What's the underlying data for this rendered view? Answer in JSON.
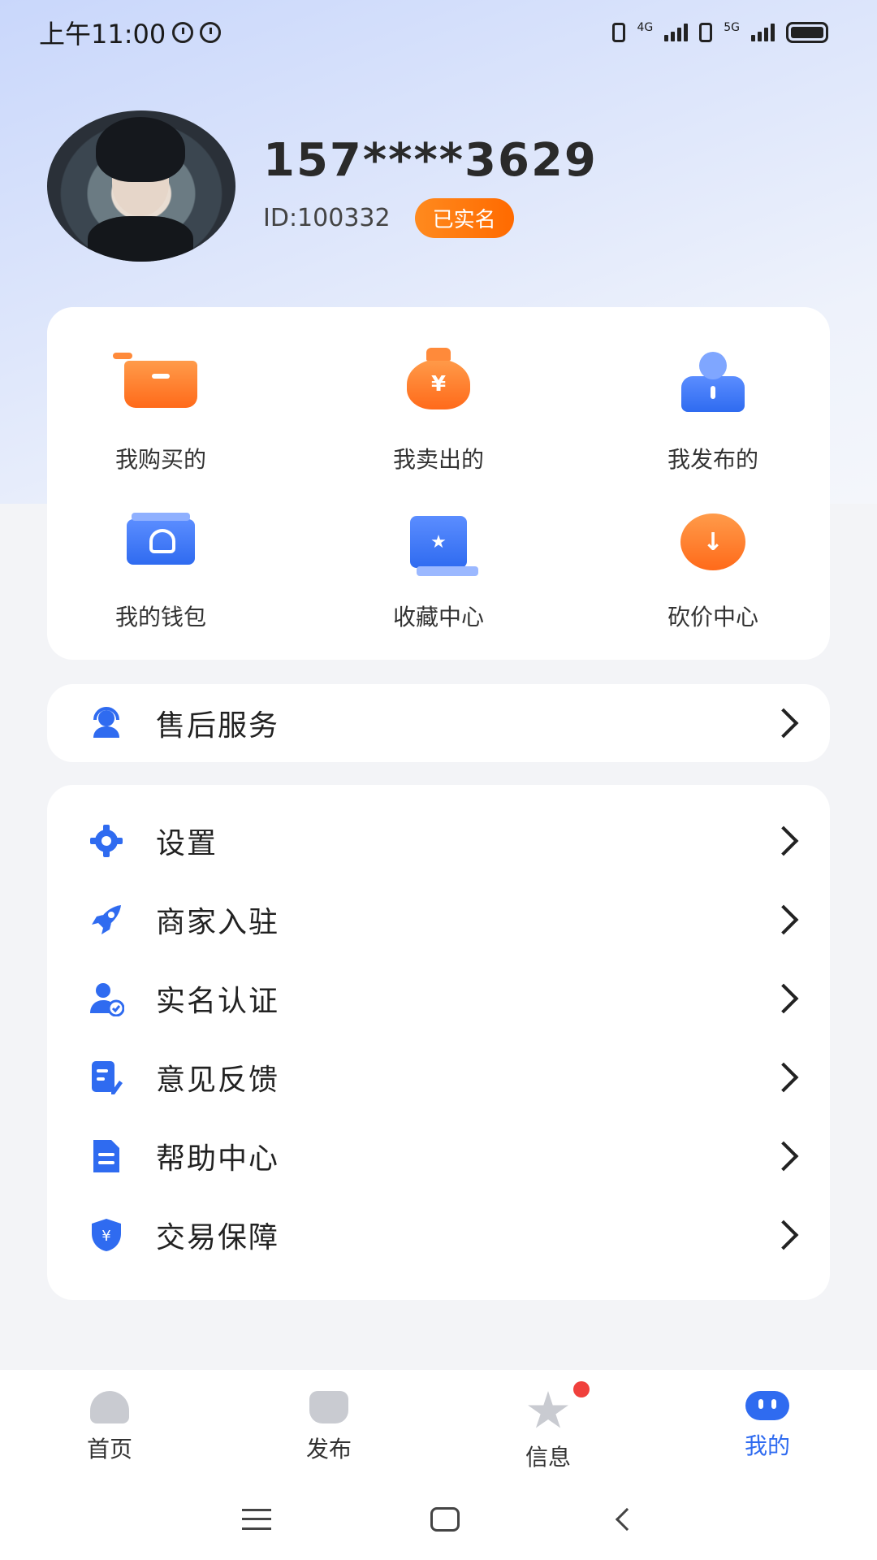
{
  "status_bar": {
    "time": "上午11:00",
    "net1": "4G",
    "net2": "5G"
  },
  "profile": {
    "phone": "157****3629",
    "user_id": "ID:100332",
    "verified_badge": "已实名"
  },
  "quick_grid": [
    {
      "label": "我购买的",
      "icon": "cart-icon"
    },
    {
      "label": "我卖出的",
      "icon": "money-bag-icon"
    },
    {
      "label": "我发布的",
      "icon": "publish-icon"
    },
    {
      "label": "我的钱包",
      "icon": "wallet-icon"
    },
    {
      "label": "收藏中心",
      "icon": "favorite-icon"
    },
    {
      "label": "砍价中心",
      "icon": "bargain-icon"
    }
  ],
  "service": {
    "label": "售后服务",
    "icon": "customer-service-icon"
  },
  "menu": [
    {
      "label": "设置",
      "icon": "gear-icon"
    },
    {
      "label": "商家入驻",
      "icon": "rocket-icon"
    },
    {
      "label": "实名认证",
      "icon": "user-verified-icon"
    },
    {
      "label": "意见反馈",
      "icon": "feedback-icon"
    },
    {
      "label": "帮助中心",
      "icon": "document-icon"
    },
    {
      "label": "交易保障",
      "icon": "shield-icon"
    }
  ],
  "tabbar": [
    {
      "label": "首页",
      "icon": "home-icon"
    },
    {
      "label": "发布",
      "icon": "bag-icon"
    },
    {
      "label": "信息",
      "icon": "star-icon"
    },
    {
      "label": "我的",
      "icon": "me-icon",
      "active": true
    }
  ],
  "colors": {
    "accent": "#2f6bf0",
    "orange": "#ff6a1a",
    "badge_red": "#f0403c"
  }
}
